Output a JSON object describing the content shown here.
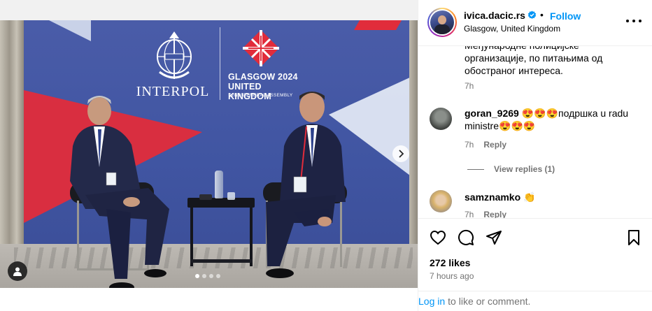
{
  "post": {
    "username": "ivica.dacic.rs",
    "separator": "•",
    "follow_label": "Follow",
    "location": "Glasgow, United Kingdom"
  },
  "media": {
    "backdrop": {
      "org_wordmark": "INTERPOL",
      "event_title_line1": "GLASGOW 2024",
      "event_title_line2": "UNITED KINGDOM",
      "event_subtitle": "92ND GENERAL ASSEMBLY"
    },
    "carousel_dots": 4,
    "active_dot": 0,
    "colors": {
      "backdrop_blue": "#4055a2",
      "accent_red": "#e12c3b"
    }
  },
  "caption": {
    "text_partial_top": "Међународне полицијске",
    "text_rest": "организације, по питањима од обостраног интереса.",
    "time": "7h"
  },
  "comments": [
    {
      "username": "goran_9269",
      "text": "😍😍😍подршка u radu ministre😍😍😍",
      "time": "7h",
      "reply_label": "Reply",
      "view_replies": "View replies (1)"
    },
    {
      "username": "samznamko",
      "text": "👏",
      "time": "7h",
      "reply_label": "Reply"
    }
  ],
  "actions": {
    "icons": [
      "heart-icon",
      "comment-icon",
      "share-icon",
      "bookmark-icon"
    ],
    "likes": "272 likes",
    "posted": "7 hours ago"
  },
  "footer": {
    "login_link": "Log in",
    "login_suffix": "to like or comment."
  },
  "theme": {
    "link_blue": "#0095f6",
    "secondary_text": "#737373",
    "verified_blue": "#0095f6"
  }
}
